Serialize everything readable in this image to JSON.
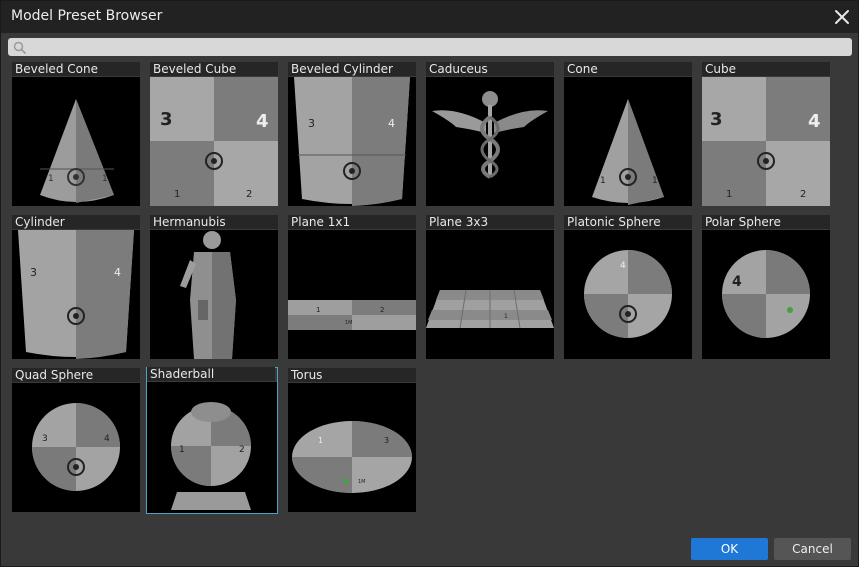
{
  "window": {
    "title": "Model Preset Browser"
  },
  "search": {
    "placeholder": "",
    "value": ""
  },
  "presets": [
    {
      "label": "Beveled Cone"
    },
    {
      "label": "Beveled Cube"
    },
    {
      "label": "Beveled Cylinder"
    },
    {
      "label": "Caduceus"
    },
    {
      "label": "Cone"
    },
    {
      "label": "Cube"
    },
    {
      "label": "Cylinder"
    },
    {
      "label": "Hermanubis"
    },
    {
      "label": "Plane 1x1"
    },
    {
      "label": "Plane 3x3"
    },
    {
      "label": "Platonic Sphere"
    },
    {
      "label": "Polar Sphere"
    },
    {
      "label": "Quad Sphere"
    },
    {
      "label": "Shaderball",
      "selected": true
    },
    {
      "label": "Torus"
    }
  ],
  "uv_marks": {
    "n1": "1",
    "n2": "2",
    "n3": "3",
    "n4": "4",
    "m": "1M"
  },
  "buttons": {
    "ok": "OK",
    "cancel": "Cancel"
  },
  "colors": {
    "accent": "#1f78d6",
    "selection": "#4aa3c2"
  },
  "icons": {
    "search": "search-icon",
    "close": "close-icon"
  }
}
